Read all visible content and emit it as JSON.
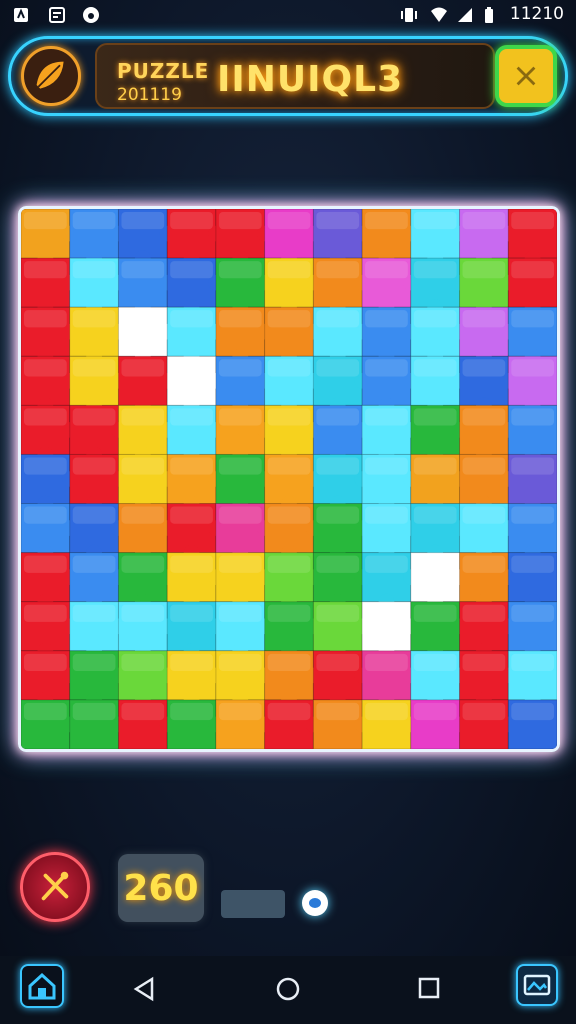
{
  "status_bar": {
    "time": "11210",
    "icons": [
      "notification-icon",
      "messaging-icon",
      "app-icon",
      "vibrate-icon",
      "wifi-icon",
      "signal-icon",
      "battery-icon"
    ]
  },
  "header": {
    "logo_icon": "leaf-logo-icon",
    "label": "PUZZLE",
    "date": "201119",
    "name": "IINUIQL3",
    "close_icon": "close-icon"
  },
  "board": {
    "rows": 11,
    "cols": 11,
    "border_colors": [
      "#ffffff",
      "#ff4fb0",
      "#5ae8ff"
    ],
    "piece_colors": [
      [
        "#f2a21e",
        "#3a8cf0",
        "#2f6ae0",
        "#ea1c2a",
        "#ea1c2a",
        "#e83cc8",
        "#6a5ad8",
        "#f28a1c",
        "#5ae8ff",
        "#c86af0",
        "#ea1c2a"
      ],
      [
        "#ea1c2a",
        "#5ae8ff",
        "#3a8cf0",
        "#2f6ae0",
        "#28b83c",
        "#f6d21e",
        "#f28a1c",
        "#e85ad8",
        "#2fcfe8",
        "#6ad83a",
        "#ea1c2a"
      ],
      [
        "#ea1c2a",
        "#f6d21e",
        "#ffffff",
        "#5ae8ff",
        "#f28a1c",
        "#f28a1c",
        "#5ae8ff",
        "#3a8cf0",
        "#5ae8ff",
        "#c86af0",
        "#3a8cf0"
      ],
      [
        "#ea1c2a",
        "#f6d21e",
        "#ea1c2a",
        "#ffffff",
        "#3a8cf0",
        "#5ae8ff",
        "#2fcfe8",
        "#3a8cf0",
        "#5ae8ff",
        "#2f6ae0",
        "#c86af0"
      ],
      [
        "#ea1c2a",
        "#ea1c2a",
        "#f6d21e",
        "#5ae8ff",
        "#f6a21e",
        "#f6d21e",
        "#3a8cf0",
        "#5ae8ff",
        "#28b83c",
        "#f28a1c",
        "#3a8cf0"
      ],
      [
        "#2f6ae0",
        "#ea1c2a",
        "#f6d21e",
        "#f6a21e",
        "#28b83c",
        "#f6a21e",
        "#2fcfe8",
        "#5ae8ff",
        "#f2a21e",
        "#f28a1c",
        "#6a5ad8"
      ],
      [
        "#3a8cf0",
        "#2f6ae0",
        "#f28a1c",
        "#ea1c2a",
        "#e83c9a",
        "#f28a1c",
        "#28b83c",
        "#5ae8ff",
        "#2fcfe8",
        "#5ae8ff",
        "#3a8cf0"
      ],
      [
        "#ea1c2a",
        "#3a8cf0",
        "#28b83c",
        "#f6d21e",
        "#f6d21e",
        "#6ad83a",
        "#28b83c",
        "#2fcfe8",
        "#ffffff",
        "#f28a1c",
        "#2f6ae0"
      ],
      [
        "#ea1c2a",
        "#5ae8ff",
        "#5ae8ff",
        "#2fcfe8",
        "#5ae8ff",
        "#28b83c",
        "#6ad83a",
        "#ffffff",
        "#28b83c",
        "#ea1c2a",
        "#3a8cf0"
      ],
      [
        "#ea1c2a",
        "#28b83c",
        "#6ad83a",
        "#f6d21e",
        "#f6d21e",
        "#f28a1c",
        "#ea1c2a",
        "#e83c9a",
        "#5ae8ff",
        "#ea1c2a",
        "#5ae8ff"
      ],
      [
        "#28b83c",
        "#28b83c",
        "#ea1c2a",
        "#28b83c",
        "#f6a21e",
        "#ea1c2a",
        "#f28a1c",
        "#f6d21e",
        "#e83cc8",
        "#ea1c2a",
        "#2f6ae0"
      ]
    ]
  },
  "controls": {
    "hint_icon": "crossed-tools-icon",
    "counter_value": "260",
    "progress_bar": "",
    "indicator_icon": "eye-dot-icon"
  },
  "nav_bar": {
    "home_icon": "home-icon",
    "back_icon": "back-triangle-icon",
    "recents_home_icon": "home-circle-icon",
    "overview_icon": "overview-square-icon",
    "gallery_icon": "gallery-icon"
  }
}
